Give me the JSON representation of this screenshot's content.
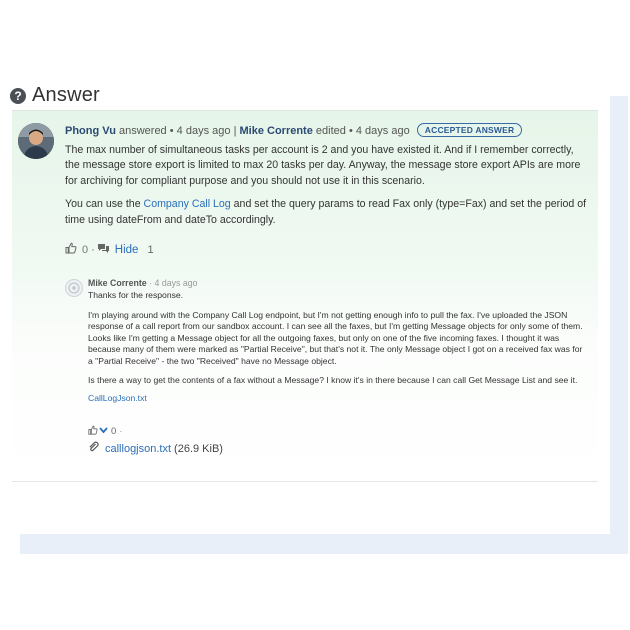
{
  "heading": {
    "icon": "question-circle-icon",
    "title": "Answer"
  },
  "answer": {
    "author": "Phong Vu",
    "answered_text": "answered",
    "answered_time": "4 days ago",
    "separator": "|",
    "editor": "Mike Corrente",
    "edited_text": "edited",
    "edited_time": "4 days ago",
    "bullet": "•",
    "badge": "ACCEPTED ANSWER",
    "paragraph1": "The max number of simultaneous tasks per account is 2 and you have existed it. And if I remember correctly, the message store export is limited to max 20 tasks per day. Anyway, the message store export APIs are more for archiving for compliant purpose and you should not use it in this scenario.",
    "paragraph2_before": "You can use the",
    "paragraph2_link": "Company Call Log",
    "paragraph2_after": "and set the query params to read Fax only (type=Fax) and set the period of time using dateFrom and dateTo accordingly.",
    "like_count": "0",
    "hide_label": "Hide",
    "comment_count": "1"
  },
  "comment": {
    "author": "Mike Corrente",
    "time": "· 4 days ago",
    "line1": "Thanks for the response.",
    "paragraph1": "I'm playing around with the Company Call Log endpoint, but I'm not getting enough info to pull the fax. I've uploaded the JSON response of a call report from our sandbox account. I can see all the faxes, but I'm getting Message objects for only some of them. Looks like I'm getting a Message object for all the outgoing faxes, but only on one of the five incoming faxes. I thought it was because many of them were marked as \"Partial Receive\", but that's not it. The only Message object I got on a received fax was for a \"Partial Receive\" - the two \"Received\" have no Message object.",
    "paragraph2": "Is there a way to get the contents of a fax without a Message? I know it's in there because I can call Get Message List and see it.",
    "attachment_link": "CallLogJson.txt",
    "vote_count": "0",
    "trailing_dot": "·"
  },
  "attachment": {
    "icon": "paperclip-icon",
    "filename": "calllogjson.txt",
    "size": "(26.9 KiB)"
  }
}
